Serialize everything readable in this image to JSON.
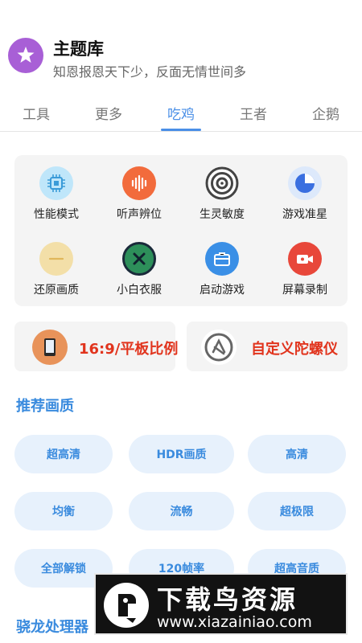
{
  "header": {
    "title": "主题库",
    "subtitle": "知恩报恩天下少，反面无情世间多"
  },
  "tabs": [
    {
      "label": "工具"
    },
    {
      "label": "更多"
    },
    {
      "label": "吃鸡",
      "active": true
    },
    {
      "label": "王者"
    },
    {
      "label": "企鹅"
    }
  ],
  "grid": [
    {
      "label": "性能模式",
      "icon": "chip-icon"
    },
    {
      "label": "听声辨位",
      "icon": "sound-wave-icon"
    },
    {
      "label": "生灵敏度",
      "icon": "target-icon"
    },
    {
      "label": "游戏准星",
      "icon": "crosshair-pie-icon"
    },
    {
      "label": "还原画质",
      "icon": "restore-icon"
    },
    {
      "label": "小白衣服",
      "icon": "close-circle-icon"
    },
    {
      "label": "启动游戏",
      "icon": "briefcase-icon"
    },
    {
      "label": "屏幕录制",
      "icon": "video-camera-icon"
    }
  ],
  "features": [
    {
      "label": "16:9/平板比例",
      "icon": "tablet-icon"
    },
    {
      "label": "自定义陀螺仪",
      "icon": "gyroscope-icon"
    }
  ],
  "quality_section": {
    "title": "推荐画质",
    "options": [
      "超高清",
      "HDR画质",
      "高清",
      "均衡",
      "流畅",
      "超极限",
      "全部解锁",
      "120帧率",
      "超高音质"
    ]
  },
  "processor_section": {
    "title": "骁龙处理器"
  },
  "watermark": {
    "title": "下载鸟资源",
    "url": "www.xiazainiao.com"
  },
  "colors": {
    "accent": "#4a8fe7",
    "logo": "#a85fd6",
    "feature_text": "#e1341d",
    "pill_bg": "#e7f1fc"
  }
}
